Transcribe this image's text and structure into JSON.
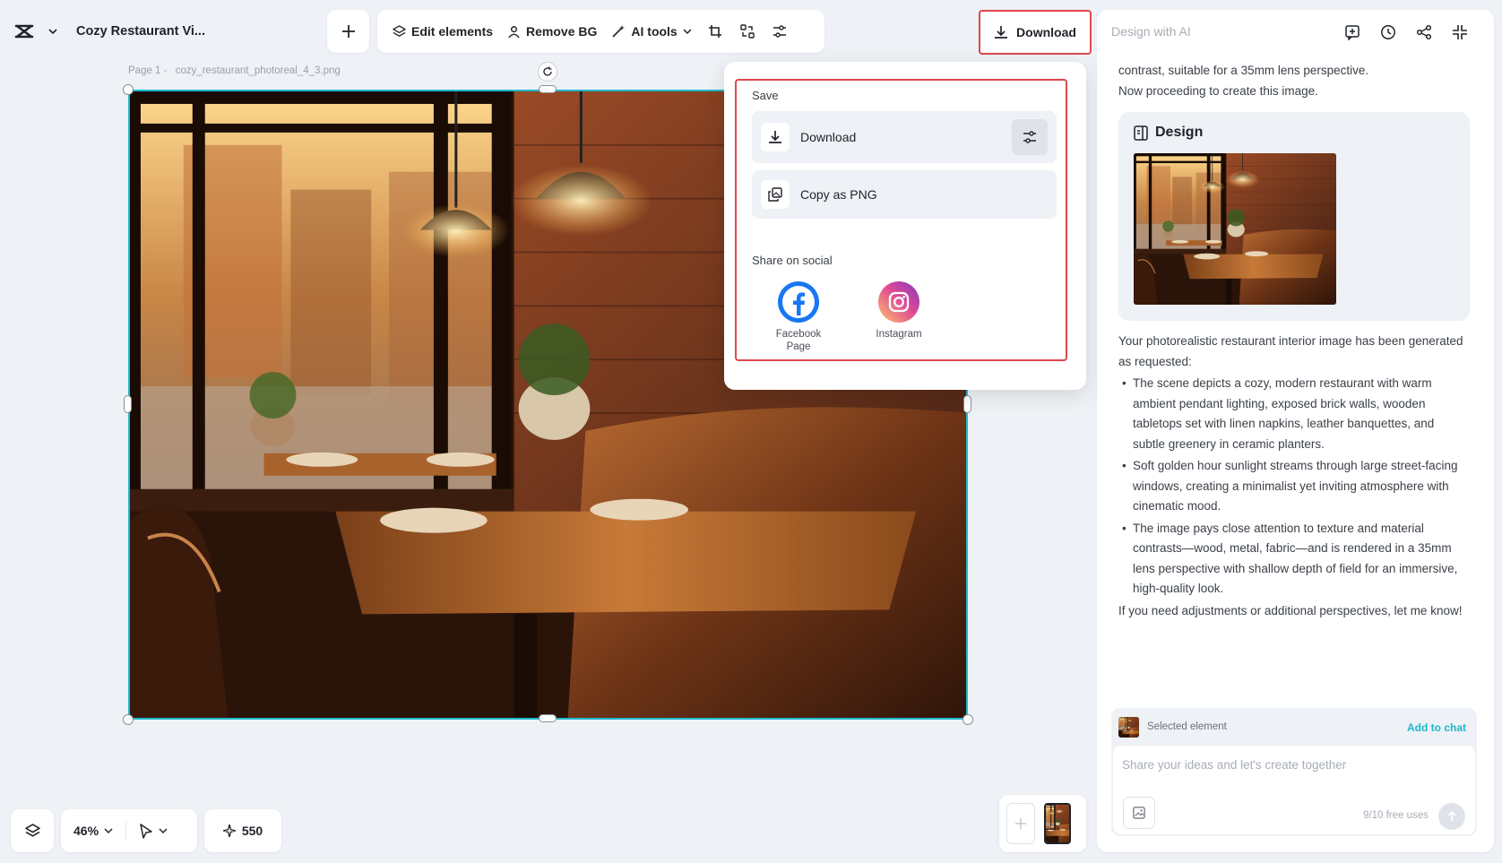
{
  "header": {
    "project_title": "Cozy Restaurant Vi...",
    "download_label": "Download"
  },
  "toolbar": {
    "edit_elements": "Edit elements",
    "remove_bg": "Remove BG",
    "ai_tools": "AI tools"
  },
  "canvas": {
    "page_label": "Page 1 -",
    "file_name": "cozy_restaurant_photoreal_4_3.png"
  },
  "download_menu": {
    "save_title": "Save",
    "download_option": "Download",
    "copy_option": "Copy as PNG",
    "share_title": "Share on social",
    "social": [
      {
        "label": "Facebook Page",
        "icon": "facebook-icon",
        "color": "#1877f2"
      },
      {
        "label": "Instagram",
        "icon": "instagram-icon"
      }
    ]
  },
  "ai_panel": {
    "title_placeholder": "Design with AI",
    "intro_line1": "contrast, suitable for a 35mm lens perspective.",
    "intro_line2": "Now proceeding to create this image.",
    "design_card_title": "Design",
    "summary": "Your photorealistic restaurant interior image has been generated as requested:",
    "bullets": [
      "The scene depicts a cozy, modern restaurant with warm ambient pendant lighting, exposed brick walls, wooden tabletops set with linen napkins, leather banquettes, and subtle greenery in ceramic planters.",
      "Soft golden hour sunlight streams through large street-facing windows, creating a minimalist yet inviting atmosphere with cinematic mood.",
      "The image pays close attention to texture and material contrasts—wood, metal, fabric—and is rendered in a 35mm lens perspective with shallow depth of field for an immersive, high-quality look."
    ],
    "closing": "If you need adjustments or additional perspectives, let me know!",
    "selected_element_label": "Selected element",
    "add_to_chat": "Add to chat",
    "input_placeholder": "Share your ideas and let's create together",
    "free_uses": "9/10 free uses"
  },
  "bottom_bar": {
    "zoom": "46%",
    "credits": "550"
  },
  "colors": {
    "accent": "#1fb8cc",
    "highlight": "#e0474c",
    "background": "#eef1f5"
  }
}
